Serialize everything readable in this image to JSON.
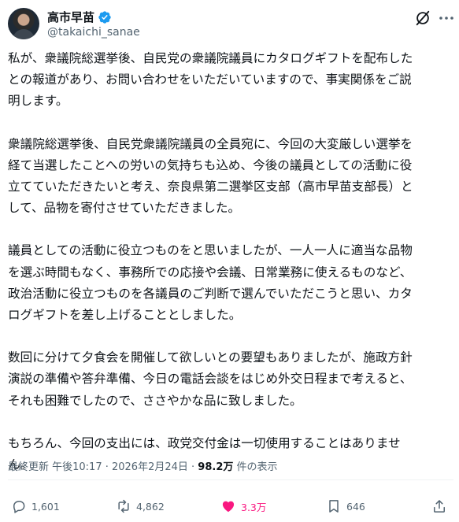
{
  "author": {
    "name": "高市早苗",
    "handle": "@takaichi_sanae",
    "verified": true,
    "verified_color": "#1d9bf0"
  },
  "post": {
    "paragraphs": [
      "私が、衆議院総選挙後、自民党の衆議院議員にカタログギフトを配布した\nとの報道があり、お問い合わせをいただいていますので、事実関係をご説\n明します。",
      "衆議院総選挙後、自民党衆議院議員の全員宛に、今回の大変厳しい選挙を\n経て当選したことへの労いの気持ちも込め、今後の議員としての活動に役\n立てていただきたいと考え、奈良県第二選挙区支部（高市早苗支部長）と\nして、品物を寄付させていただきました。",
      "議員としての活動に役立つものをと思いましたが、一人一人に適当な品物\nを選ぶ時間もなく、事務所での応接や会議、日常業務に使えるものなど、\n政治活動に役立つものを各議員のご判断で選んでいただこうと思い、カタ\nログギフトを差し上げることとしました。",
      "数回に分けて夕食会を開催して欲しいとの要望もありましたが、施政方針\n演説の準備や答弁準備、今日の電話会談をはじめ外交日程まで考えると、\nそれも困難でしたので、ささやかな品に致しました。",
      "もちろん、今回の支出には、政党交付金は一切使用することはありませ\nん。"
    ],
    "meta_prefix": "最終更新 午後10:17 · 2026年2月24日 · ",
    "views": "98.2万",
    "views_suffix": " 件の表示"
  },
  "actions": {
    "replies": "1,601",
    "reposts": "4,862",
    "likes": "3.3万",
    "bookmarks": "646"
  },
  "icons": {
    "grok": "grok-icon",
    "more": "more-dots-icon",
    "reply": "reply-bubble-icon",
    "repost": "repost-icon",
    "like": "heart-icon",
    "bookmark": "bookmark-icon",
    "share": "share-upload-icon"
  },
  "colors": {
    "text": "#0f1419",
    "secondary": "#536471",
    "like_active": "#f91880",
    "verified": "#1d9bf0"
  }
}
